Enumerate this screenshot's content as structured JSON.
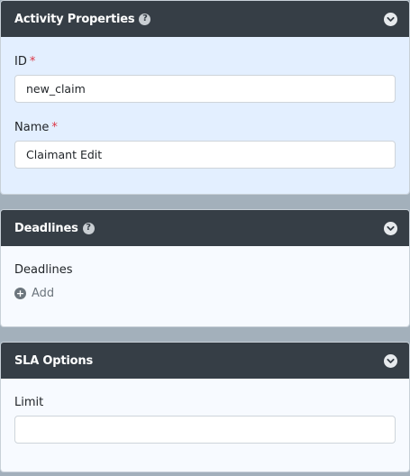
{
  "activity_panel": {
    "title": "Activity Properties",
    "help_icon": "question-circle-icon",
    "collapse_icon": "chevron-down-icon",
    "id_field": {
      "label": "ID",
      "required_mark": "*",
      "value": "new_claim"
    },
    "name_field": {
      "label": "Name",
      "required_mark": "*",
      "value": "Claimant Edit"
    }
  },
  "deadlines_panel": {
    "title": "Deadlines",
    "help_icon": "question-circle-icon",
    "collapse_icon": "chevron-down-icon",
    "section_label": "Deadlines",
    "add_label": "Add",
    "add_icon": "plus-circle-icon"
  },
  "sla_panel": {
    "title": "SLA Options",
    "collapse_icon": "chevron-down-icon",
    "limit_field": {
      "label": "Limit",
      "value": ""
    }
  },
  "colors": {
    "header_bg": "#363e46",
    "active_body_bg": "#e3efff",
    "body_bg": "#f7faff",
    "page_bg": "#a3b0bb",
    "required": "#dc3545",
    "muted": "#6c757d"
  }
}
